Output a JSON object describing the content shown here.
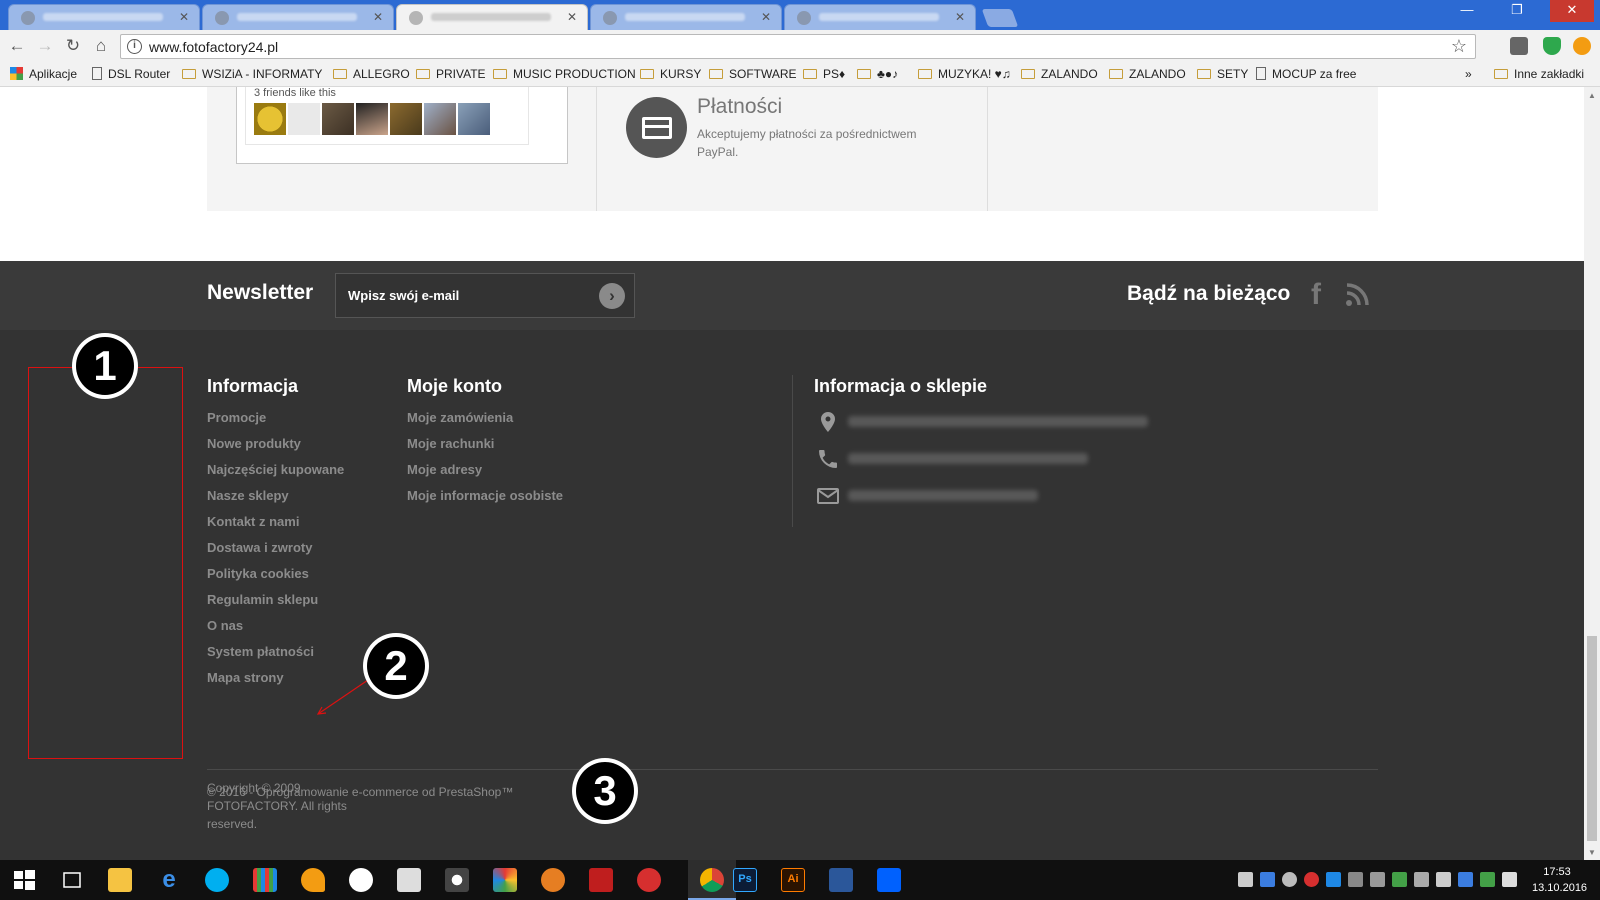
{
  "browser": {
    "url": "www.fotofactory24.pl",
    "bookmarks": [
      {
        "label": "Aplikacje",
        "type": "apps"
      },
      {
        "label": "DSL Router",
        "type": "page"
      },
      {
        "label": "WSIZiA - INFORMATY",
        "type": "folder"
      },
      {
        "label": "ALLEGRO",
        "type": "folder"
      },
      {
        "label": "PRIVATE",
        "type": "folder"
      },
      {
        "label": "MUSIC PRODUCTION",
        "type": "folder"
      },
      {
        "label": "KURSY",
        "type": "folder"
      },
      {
        "label": "SOFTWARE",
        "type": "folder"
      },
      {
        "label": "PS♦",
        "type": "folder"
      },
      {
        "label": "♣●♪",
        "type": "folder"
      },
      {
        "label": "MUZYKA! ♥♫",
        "type": "folder"
      },
      {
        "label": "ZALANDO",
        "type": "folder"
      },
      {
        "label": "ZALANDO",
        "type": "folder"
      },
      {
        "label": "SETY",
        "type": "folder"
      },
      {
        "label": "MOCUP za free",
        "type": "page"
      }
    ],
    "more": "»",
    "other_bookmarks": "Inne zakładki"
  },
  "top_section": {
    "fb_friends_text": "3 friends like this",
    "payments": {
      "title": "Płatności",
      "description": "Akceptujemy płatności za pośrednictwem PayPal."
    }
  },
  "newsletter": {
    "title": "Newsletter",
    "placeholder": "Wpisz swój e-mail",
    "social_title": "Bądź na bieżąco",
    "facebook_glyph": "f"
  },
  "footer": {
    "info_title": "Informacja",
    "info_links": [
      "Promocje",
      "Nowe produkty",
      "Najczęściej kupowane",
      "Nasze sklepy",
      "Kontakt z nami",
      "Dostawa i zwroty",
      "Polityka cookies",
      "Regulamin sklepu",
      "O nas",
      "System płatności",
      "Mapa strony"
    ],
    "account_title": "Moje konto",
    "account_links": [
      "Moje zamówienia",
      "Moje rachunki",
      "Moje adresy",
      "Moje informacje osobiste"
    ],
    "store_title": "Informacja o sklepie",
    "store_rows": [
      {
        "icon": "location-pin-icon"
      },
      {
        "icon": "phone-icon"
      },
      {
        "icon": "envelope-icon"
      }
    ],
    "copyright": "Copyright © 2009 FOTOFACTORY. All rights reserved.",
    "prestashop": "© 2016 - Oprogramowanie e-commerce od PrestaShop™"
  },
  "annotations": {
    "markers": [
      "1",
      "2",
      "3"
    ],
    "color": "#dd1111"
  },
  "taskbar": {
    "time": "17:53",
    "date": "13.10.2016",
    "apps": [
      "start",
      "task-view",
      "file-explorer",
      "edge",
      "skype",
      "store-tiles",
      "fl-studio",
      "hp",
      "windows-store",
      "camera",
      "color-app",
      "game",
      "filezilla",
      "recorder",
      "chrome",
      "photoshop",
      "illustrator",
      "word",
      "dropbox"
    ]
  },
  "colors": {
    "footer_bg": "#333333",
    "newsletter_bg": "#3a3a3a",
    "link_color": "#8c8c8c",
    "chrome_tabstrip": "#2c6ad3"
  }
}
